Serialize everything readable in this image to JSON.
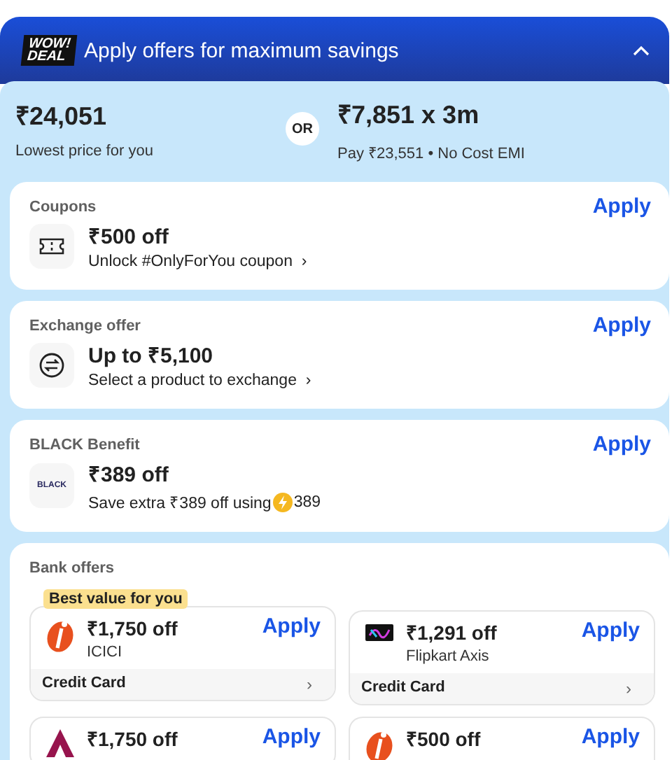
{
  "header": {
    "logo": [
      "WOW!",
      "DEAL"
    ],
    "title": "Apply offers for maximum savings",
    "expanded": true
  },
  "prices": {
    "best": "₹24,051",
    "best_label": "Lowest price for you",
    "separator": "OR",
    "emi": "₹7,851 x 3m",
    "emi_label": "Pay ₹23,551 • No Cost EMI"
  },
  "offers": [
    {
      "kind": "coupon",
      "title": "Coupons",
      "action": "Apply",
      "amount": "₹500 off",
      "detail": "Unlock #OnlyForYou coupon",
      "more": "›"
    },
    {
      "kind": "exchange",
      "title": "Exchange offer",
      "action": "Apply",
      "amount": "Up to ₹5,100",
      "detail": "Select a product to exchange",
      "more": "›"
    },
    {
      "kind": "black",
      "title": "BLACK Benefit",
      "action": "Apply",
      "amount": "₹389 off",
      "detail": "Save extra ₹389 off using",
      "coins": "389",
      "logo": "BLACK"
    }
  ],
  "bank_offers": {
    "title": "Bank offers",
    "cards": [
      {
        "kind": "icici",
        "badge": "Best value for you",
        "amount": "₹1,750 off",
        "name": "ICICI",
        "action": "Apply",
        "card_type": "Credit Card",
        "more": "›"
      },
      {
        "kind": "flipkart",
        "amount": "₹1,291 off",
        "name": "Flipkart Axis",
        "action": "Apply",
        "card_type": "Credit Card",
        "more": "›"
      },
      {
        "kind": "axis",
        "amount": "₹1,750 off",
        "action": "Apply"
      },
      {
        "kind": "icici",
        "amount": "₹500 off",
        "action": "Apply"
      }
    ]
  }
}
